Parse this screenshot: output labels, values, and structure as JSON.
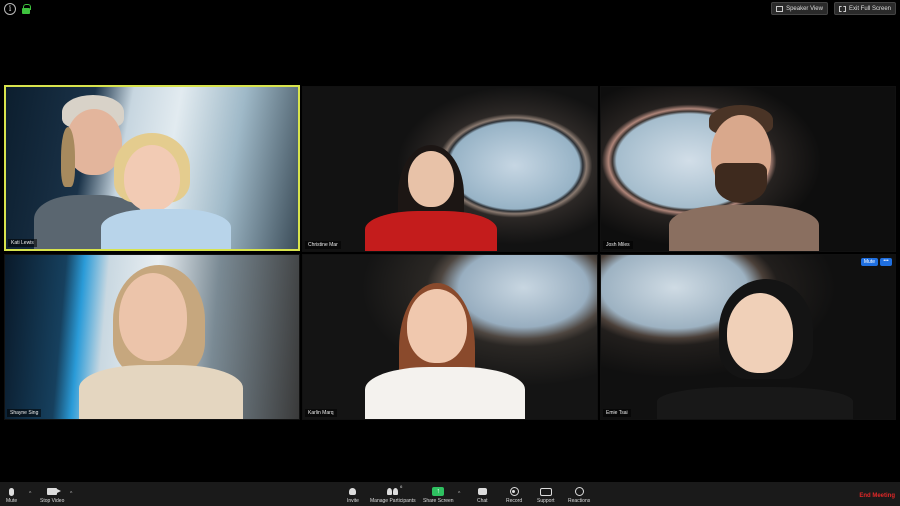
{
  "top_bar": {
    "speaker_view_label": "Speaker View",
    "exit_fullscreen_label": "Exit Full Screen"
  },
  "participants": [
    {
      "name": "Kati Lewis",
      "active": true
    },
    {
      "name": "Christine Mar",
      "active": false
    },
    {
      "name": "Josh Miles",
      "active": false
    },
    {
      "name": "Shayne Sing",
      "active": false
    },
    {
      "name": "Karlin Marq",
      "active": false
    },
    {
      "name": "Emie Tsai",
      "active": false
    }
  ],
  "tile_controls": {
    "mute_label": "Mute",
    "more_label": "•••"
  },
  "toolbar": {
    "mute_label": "Mute",
    "stop_video_label": "Stop Video",
    "invite_label": "Invite",
    "manage_participants_label": "Manage Participants",
    "participant_count": "6",
    "share_screen_label": "Share Screen",
    "chat_label": "Chat",
    "record_label": "Record",
    "support_label": "Support",
    "reactions_label": "Reactions",
    "end_meeting_label": "End Meeting"
  },
  "colors": {
    "active_speaker_border": "#d8e34d",
    "end_meeting": "#e02828",
    "share_screen": "#2ec060",
    "tile_button": "#1f6fe0"
  }
}
